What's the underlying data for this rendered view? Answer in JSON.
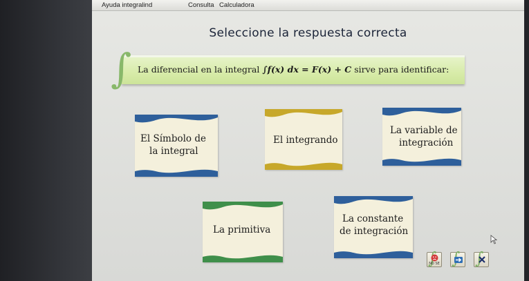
{
  "menu": {
    "items": [
      "Ayuda integralind",
      "Consulta",
      "Calculadora"
    ]
  },
  "title": "Seleccione la respuesta correcta",
  "question": {
    "prefix": "La diferencial en la integral",
    "formula": "∫f(x) dx = F(x) + C",
    "suffix": "sirve para identificar:"
  },
  "options": [
    {
      "line1": "El Símbolo de",
      "line2": "la integral"
    },
    {
      "line1": "El integrando",
      "line2": ""
    },
    {
      "line1": "La variable de",
      "line2": "integración"
    },
    {
      "line1": "La primitiva",
      "line2": ""
    },
    {
      "line1": "La constante",
      "line2": "de integración"
    }
  ],
  "colors": {
    "wave_blue": "#2e5f9b",
    "wave_gold": "#c7a82a",
    "wave_green": "#3f8f4a",
    "question_bg": "#d7eba8",
    "title_text": "#1b2438"
  },
  "footer_buttons": [
    {
      "icon": "sad-face-icon",
      "label": "NO SE"
    },
    {
      "icon": "next-arrow-icon",
      "label": ""
    },
    {
      "icon": "close-x-icon",
      "label": ""
    }
  ]
}
